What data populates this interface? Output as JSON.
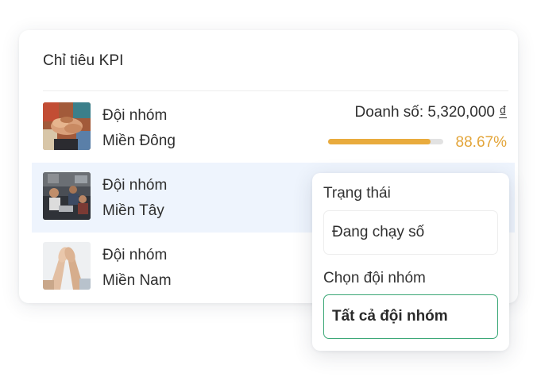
{
  "card": {
    "title": "Chỉ tiêu KPI"
  },
  "teams": [
    {
      "name_line1": "Đội nhóm",
      "name_line2": "Miền Đông",
      "sales_label": "Doanh số: 5,320,000",
      "currency": "₫",
      "progress": 0.8867,
      "progress_text": "88.67%",
      "image": "team-hands-photo"
    },
    {
      "name_line1": "Đội nhóm",
      "name_line2": "Miền Tây",
      "image": "office-meeting-photo",
      "selected": true
    },
    {
      "name_line1": "Đội nhóm",
      "name_line2": "Miền Nam",
      "image": "high-five-photo"
    }
  ],
  "filter_popup": {
    "status_label": "Trạng thái",
    "status_value": "Đang chạy số",
    "team_label": "Chọn đội nhóm",
    "team_value": "Tất cả đội nhóm"
  },
  "colors": {
    "progress": "#e9ab3d",
    "selected_row": "#eef4fd",
    "focus_border": "#3aa776"
  }
}
